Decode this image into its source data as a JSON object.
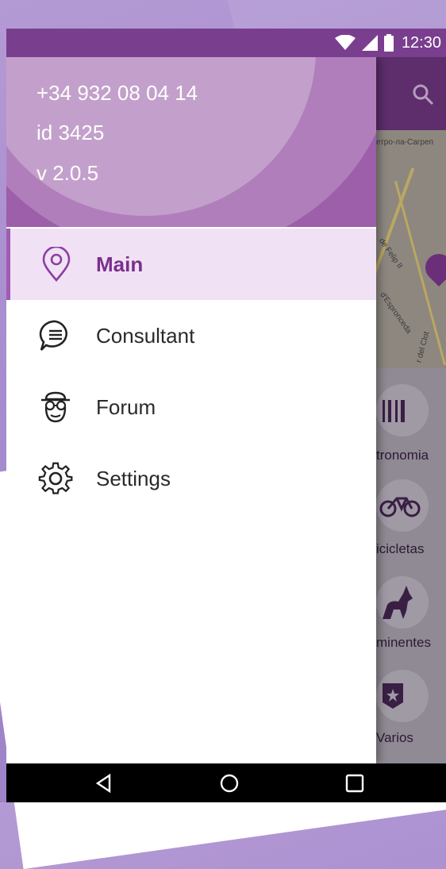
{
  "status_bar": {
    "time": "12:30",
    "icons": [
      "wifi-icon",
      "signal-icon",
      "battery-icon"
    ]
  },
  "app_behind": {
    "search_icon": "search-icon",
    "map_labels": [
      "етро-ла-Сагреп",
      "de Felip II",
      "d'Espronceda",
      "r del Clot"
    ],
    "categories": [
      {
        "label": "tronomia",
        "icon": "fork-knife-icon"
      },
      {
        "label": "icicletas",
        "icon": "bicycle-icon"
      },
      {
        "label": "minentes",
        "icon": "horse-rider-icon"
      },
      {
        "label": "Varios",
        "icon": "star-badge-icon"
      }
    ]
  },
  "drawer": {
    "header": {
      "phone": "+34 932 08 04 14",
      "id": "id 3425",
      "version": "v 2.0.5"
    },
    "items": [
      {
        "label": "Main",
        "icon": "location-pin-icon",
        "active": true
      },
      {
        "label": "Consultant",
        "icon": "chat-bubble-icon",
        "active": false
      },
      {
        "label": "Forum",
        "icon": "person-hat-icon",
        "active": false
      },
      {
        "label": "Settings",
        "icon": "gear-icon",
        "active": false
      }
    ]
  },
  "system_nav": [
    "back-icon",
    "home-icon",
    "recents-icon"
  ],
  "colors": {
    "primary": "#8e4b9c",
    "primary_dark": "#7a3e8e",
    "accent": "#7b2f8e",
    "active_bg": "#f0e2f4"
  }
}
